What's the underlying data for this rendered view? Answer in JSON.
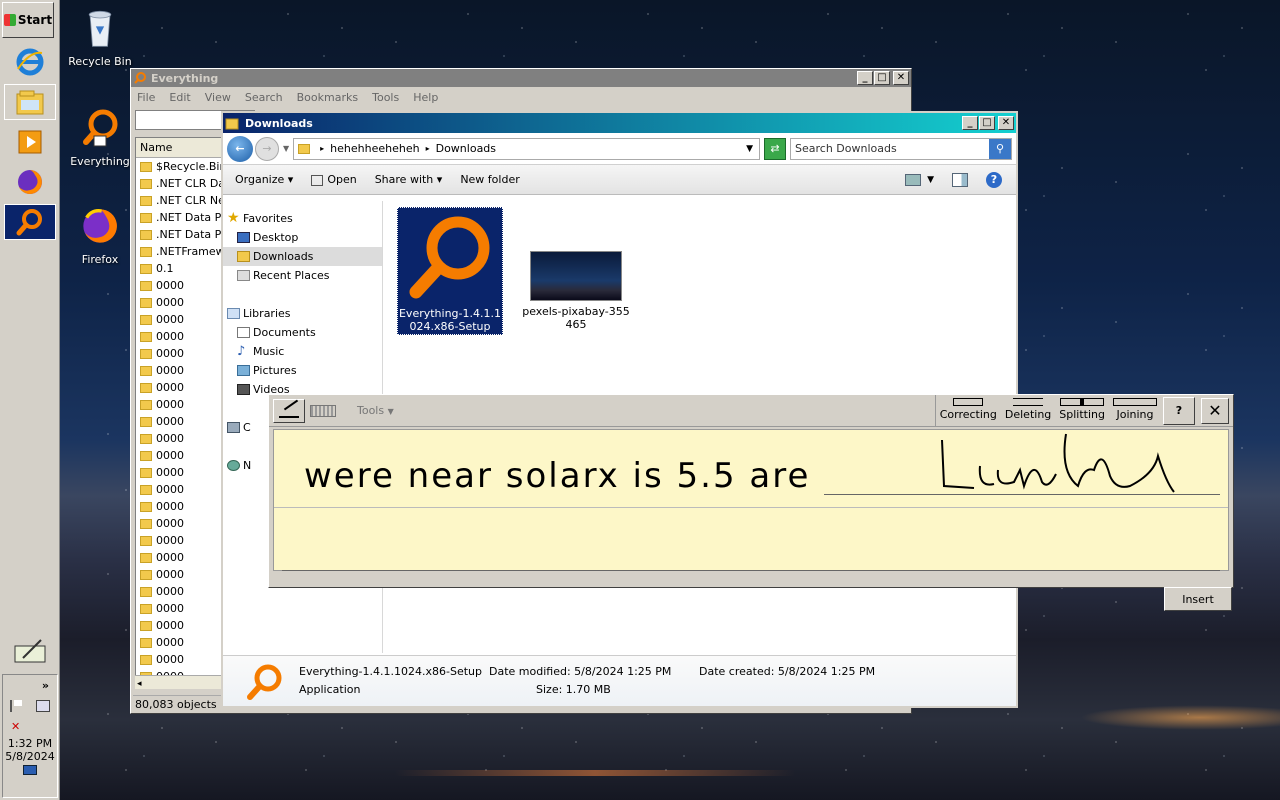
{
  "taskbar": {
    "start_label": "Start",
    "clock_time": "1:32 PM",
    "clock_date": "5/8/2024",
    "tray_expand": "»"
  },
  "desktop": {
    "icons": [
      {
        "label": "Recycle Bin",
        "icon": "recycle-bin-icon"
      },
      {
        "label": "Everything",
        "icon": "everything-icon"
      },
      {
        "label": "Firefox",
        "icon": "firefox-icon"
      }
    ]
  },
  "everything_window": {
    "title": "Everything",
    "menu": [
      "File",
      "Edit",
      "View",
      "Search",
      "Bookmarks",
      "Tools",
      "Help"
    ],
    "column_name": "Name",
    "rows": [
      "$Recycle.Bin",
      ".NET CLR Dat",
      ".NET CLR Net",
      ".NET Data Pr",
      ".NET Data Pr",
      ".NETFramewo",
      "0.1",
      "0000",
      "0000",
      "0000",
      "0000",
      "0000",
      "0000",
      "0000",
      "0000",
      "0000",
      "0000",
      "0000",
      "0000",
      "0000",
      "0000",
      "0000",
      "0000",
      "0000",
      "0000",
      "0000",
      "0000",
      "0000",
      "0000",
      "0000",
      "0000"
    ],
    "status": "80,083 objects"
  },
  "explorer_window": {
    "title": "Downloads",
    "breadcrumb": [
      "hehehheeheheh",
      "Downloads"
    ],
    "search_placeholder": "Search Downloads",
    "commands": [
      "Organize",
      "Open",
      "Share with",
      "New folder"
    ],
    "nav": {
      "favorites": "Favorites",
      "favorites_items": [
        "Desktop",
        "Downloads",
        "Recent Places"
      ],
      "libraries": "Libraries",
      "libraries_items": [
        "Documents",
        "Music",
        "Pictures",
        "Videos"
      ],
      "computer_initial": "C",
      "network_initial": "N"
    },
    "files": [
      {
        "name": "Everything-1.4.1.1024.x86-Setup",
        "line1": "Everything-1.4.1.1",
        "line2": "024.x86-Setup"
      },
      {
        "name": "pexels-pixabay-355465",
        "line1": "pexels-pixabay-355",
        "line2": "465"
      }
    ],
    "details": {
      "filename": "Everything-1.4.1.1024.x86-Setup",
      "type": "Application",
      "modified_label": "Date modified:",
      "modified": "5/8/2024 1:25 PM",
      "created_label": "Date created:",
      "created": "5/8/2024 1:25 PM",
      "size_label": "Size:",
      "size": "1.70 MB"
    }
  },
  "tablet_input": {
    "tools_label": "Tools",
    "buttons": [
      "Correcting",
      "Deleting",
      "Splitting",
      "Joining"
    ],
    "help_label": "?",
    "recognized_text": "were near solarx is 5.5 are",
    "insert_label": "Insert"
  },
  "colors": {
    "active_caption_start": "#0a246a",
    "active_caption_end": "#14d0d0",
    "inactive_caption": "#808080",
    "selection": "#0a246a",
    "everything_orange": "#f57c00",
    "tip_writing_bg": "#fdf7c8"
  }
}
